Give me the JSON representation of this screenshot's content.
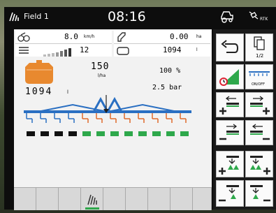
{
  "status_bar": {
    "field_name": "Field 1",
    "time": "08:16",
    "rtk_label": "RTK"
  },
  "readouts": {
    "speed_value": "8.0",
    "speed_unit": "km/h",
    "area_value": "0.00",
    "area_unit": "ha",
    "fill_level_value": "12",
    "tank_value": "1094",
    "tank_unit": "l"
  },
  "application": {
    "rate_target": "150",
    "rate_unit": "l/ha",
    "rate_percent": "100 %",
    "tank_volume": "1094",
    "tank_unit": "l",
    "pressure": "2.5 bar"
  },
  "boom": {
    "sections_total": 12,
    "sections_on_from_index": 4,
    "active_color": "#e06a2a",
    "inactive_color": "#2a6fc2"
  },
  "side_panel": {
    "page_label": "1/2",
    "on_off_label": "ON/OFF"
  },
  "colors": {
    "accent_green": "#2ea84b",
    "boom_blue": "#2a6fc2",
    "tank_orange": "#e8892f"
  }
}
